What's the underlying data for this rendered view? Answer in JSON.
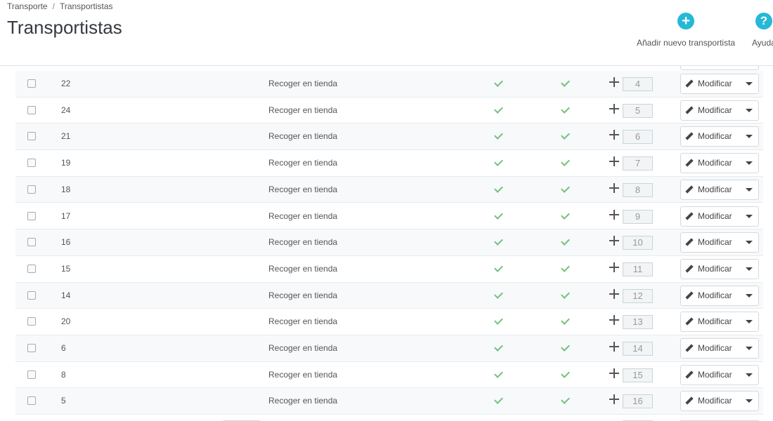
{
  "breadcrumb": {
    "parent": "Transporte",
    "current": "Transportistas",
    "separator": "/"
  },
  "page": {
    "title": "Transportistas"
  },
  "toolbar": {
    "add": {
      "label": "Añadir nuevo transportista",
      "icon": "plus-circle-icon"
    },
    "help": {
      "label": "Ayuda",
      "icon": "question-circle-icon"
    }
  },
  "row_action": {
    "edit_label": "Modificar"
  },
  "colors": {
    "accent": "#25b9d7",
    "check": "#72c279"
  },
  "rows": [
    {
      "id": "22",
      "name": "Recoger en tienda",
      "position": "4"
    },
    {
      "id": "24",
      "name": "Recoger en tienda",
      "position": "5"
    },
    {
      "id": "21",
      "name": "Recoger en tienda",
      "position": "6"
    },
    {
      "id": "19",
      "name": "Recoger en tienda",
      "position": "7"
    },
    {
      "id": "18",
      "name": "Recoger en tienda",
      "position": "8"
    },
    {
      "id": "17",
      "name": "Recoger en tienda",
      "position": "9"
    },
    {
      "id": "16",
      "name": "Recoger en tienda",
      "position": "10"
    },
    {
      "id": "15",
      "name": "Recoger en tienda",
      "position": "11"
    },
    {
      "id": "14",
      "name": "Recoger en tienda",
      "position": "12"
    },
    {
      "id": "20",
      "name": "Recoger en tienda",
      "position": "13"
    },
    {
      "id": "6",
      "name": "Recoger en tienda",
      "position": "14"
    },
    {
      "id": "8",
      "name": "Recoger en tienda",
      "position": "15"
    },
    {
      "id": "5",
      "name": "Recoger en tienda",
      "position": "16"
    }
  ]
}
